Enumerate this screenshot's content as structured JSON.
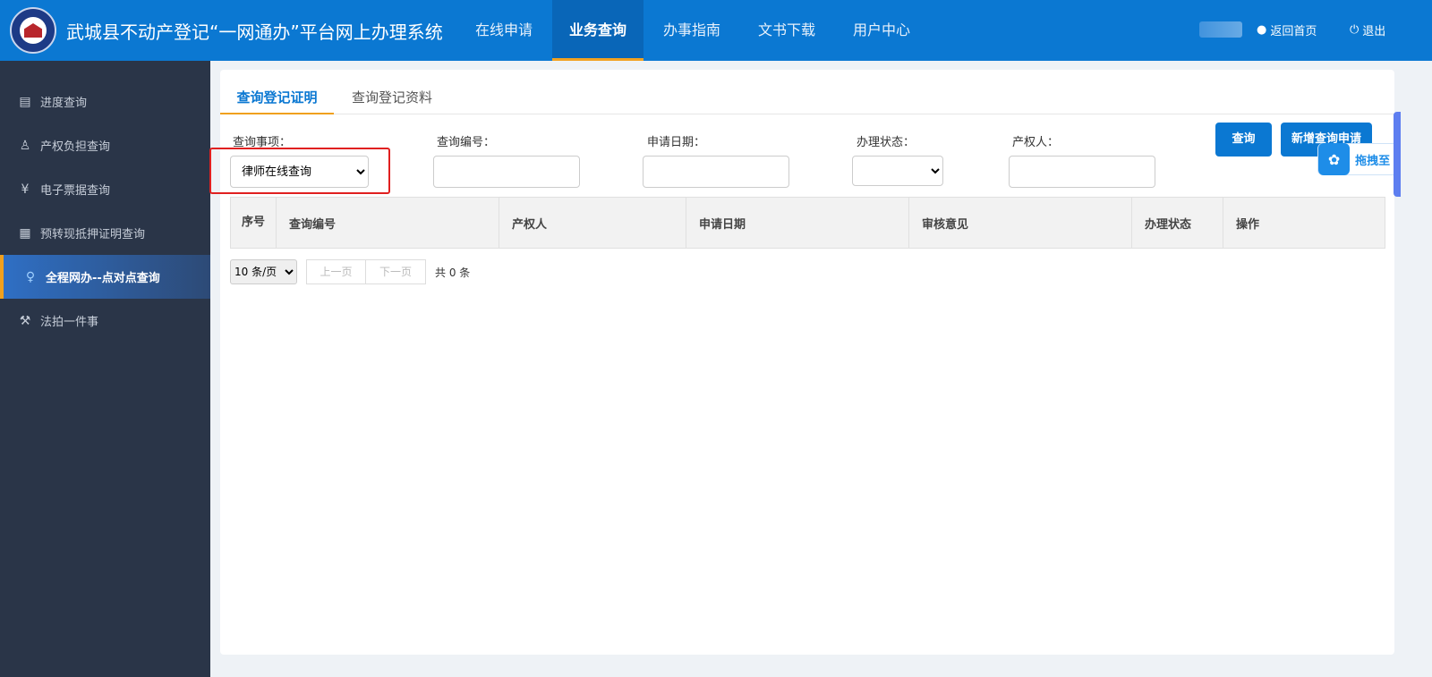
{
  "header": {
    "title": "武城县不动产登记“一网通办”平台网上办理系统",
    "nav": [
      {
        "label": "在线申请"
      },
      {
        "label": "业务查询",
        "active": true
      },
      {
        "label": "办事指南"
      },
      {
        "label": "文书下载"
      },
      {
        "label": "用户中心"
      }
    ],
    "home_link": "返回首页",
    "logout": "退出"
  },
  "sidebar": {
    "items": [
      {
        "label": "进度查询",
        "icon": "document-search-icon"
      },
      {
        "label": "产权负担查询",
        "icon": "stamp-icon"
      },
      {
        "label": "电子票据查询",
        "icon": "yuan-receipt-icon"
      },
      {
        "label": "预转现抵押证明查询",
        "icon": "certificate-icon"
      },
      {
        "label": "全程网办--点对点查询",
        "icon": "user-icon",
        "active": true
      },
      {
        "label": "法拍一件事",
        "icon": "gavel-icon"
      }
    ]
  },
  "tabs": [
    {
      "label": "查询登记证明",
      "active": true
    },
    {
      "label": "查询登记资料"
    }
  ],
  "form": {
    "item_label": "查询事项：",
    "item_value": "律师在线查询",
    "no_label": "查询编号：",
    "no_value": "",
    "date_label": "申请日期：",
    "date_value": "",
    "status_label": "办理状态：",
    "status_value": "",
    "owner_label": "产权人：",
    "owner_value": "",
    "search_btn": "查询",
    "new_btn": "新增查询申请"
  },
  "table": {
    "columns": [
      "序号",
      "查询编号",
      "产权人",
      "申请日期",
      "审核意见",
      "办理状态",
      "操作"
    ],
    "rows": []
  },
  "pager": {
    "page_size": "10 条/页",
    "prev": "上一页",
    "next": "下一页",
    "total": "共 0 条"
  },
  "float_widget": {
    "label": "拖拽至"
  },
  "colors": {
    "primary": "#0b78d2",
    "sidebar": "#2a3548",
    "accent": "#f0a01e",
    "highlight": "#e02020"
  }
}
